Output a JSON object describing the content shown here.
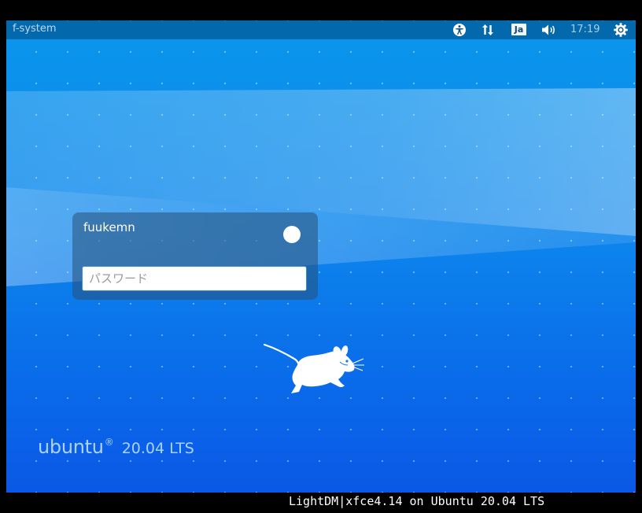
{
  "top_panel": {
    "hostname": "f-system",
    "accessibility_icon": "accessibility-icon",
    "network_icon": "network-arrows-icon",
    "language": "Ja",
    "volume_icon": "volume-icon",
    "clock": "17:19",
    "power_icon": "power-gear-icon"
  },
  "login": {
    "username": "fuukemn",
    "session_icon": "session-toggle-icon",
    "password_placeholder": "パスワード",
    "password_value": ""
  },
  "branding": {
    "logo_icon": "xfce-mouse-icon",
    "ubuntu_word": "ubuntu",
    "ubuntu_mark": "®",
    "version": "20.04 LTS"
  },
  "footer": {
    "text": "LightDM|xfce4.14 on Ubuntu 20.04 LTS"
  },
  "colors": {
    "background_top": "#0a96ec",
    "background_bottom": "#0a58e6",
    "panel": "#11557f",
    "accent": "#3a8ad8"
  }
}
